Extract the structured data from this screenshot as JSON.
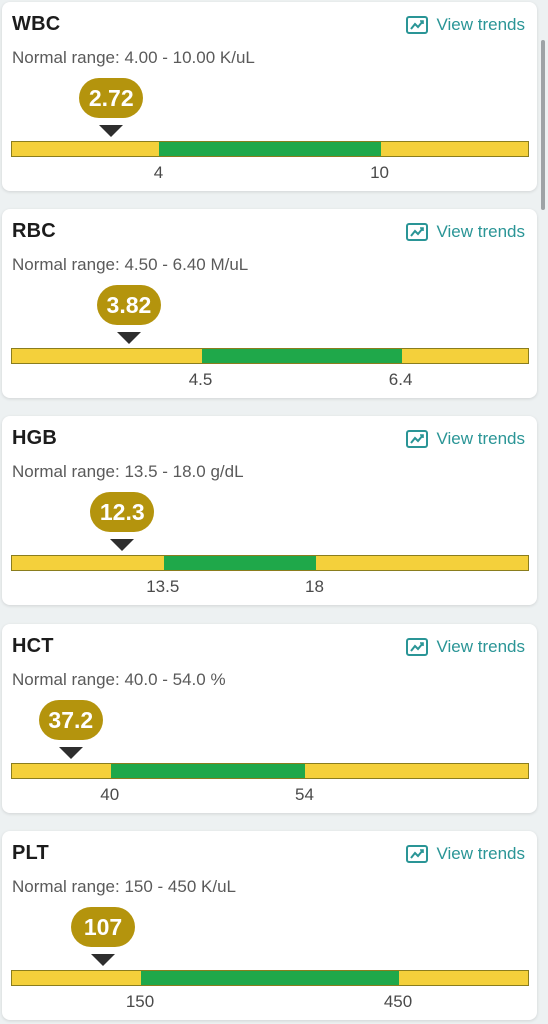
{
  "trends_label": "View trends",
  "colors": {
    "bubble": "#b4940d",
    "normal_band": "#1fa84a",
    "out_of_range_band": "#f4d03b",
    "link": "#2a9596"
  },
  "tests": [
    {
      "name": "WBC",
      "range_label": "Normal range:",
      "range_text": "4.00 - 10.00 K/uL",
      "value": "2.72",
      "low_tick": "4",
      "high_tick": "10",
      "scale": {
        "value": 2.72,
        "low": 4,
        "high": 10,
        "min": 0,
        "max": 14
      }
    },
    {
      "name": "RBC",
      "range_label": "Normal range:",
      "range_text": "4.50 - 6.40 M/uL",
      "value": "3.82",
      "low_tick": "4.5",
      "high_tick": "6.4",
      "scale": {
        "value": 3.82,
        "low": 4.5,
        "high": 6.4,
        "min": 2.7,
        "max": 7.6
      }
    },
    {
      "name": "HGB",
      "range_label": "Normal range:",
      "range_text": "13.5 - 18.0 g/dL",
      "value": "12.3",
      "low_tick": "13.5",
      "high_tick": "18",
      "scale": {
        "value": 12.3,
        "low": 13.5,
        "high": 18,
        "min": 9.0,
        "max": 24.3
      }
    },
    {
      "name": "HCT",
      "range_label": "Normal range:",
      "range_text": "40.0 - 54.0 %",
      "value": "37.2",
      "low_tick": "40",
      "high_tick": "54",
      "scale": {
        "value": 37.2,
        "low": 40,
        "high": 54,
        "min": 32.9,
        "max": 70
      }
    },
    {
      "name": "PLT",
      "range_label": "Normal range:",
      "range_text": "150 - 450 K/uL",
      "value": "107",
      "low_tick": "150",
      "high_tick": "450",
      "scale": {
        "value": 107,
        "low": 150,
        "high": 450,
        "min": 0,
        "max": 600
      }
    }
  ]
}
